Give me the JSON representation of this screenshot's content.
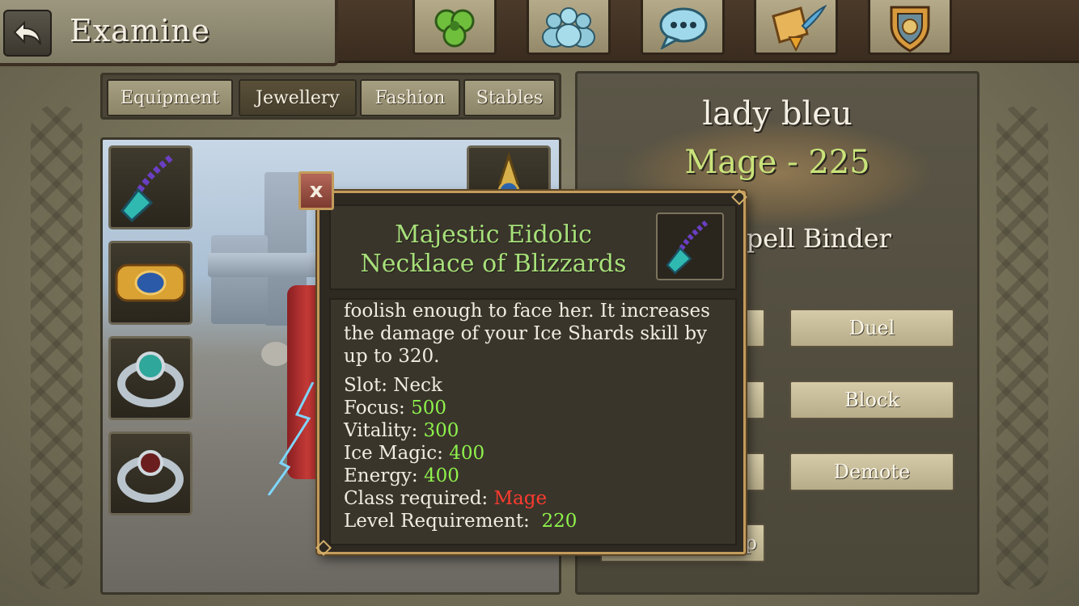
{
  "header": {
    "title": "Examine",
    "back_icon": "back-arrow-icon",
    "nav": [
      {
        "name": "triskele-icon"
      },
      {
        "name": "friends-icon"
      },
      {
        "name": "chat-icon"
      },
      {
        "name": "quest-scroll-icon"
      },
      {
        "name": "guild-shield-icon"
      }
    ]
  },
  "tabs": [
    {
      "label": "Equipment",
      "active": false
    },
    {
      "label": "Jewellery",
      "active": true
    },
    {
      "label": "Fashion",
      "active": false
    },
    {
      "label": "Stables",
      "active": false
    }
  ],
  "slots": [
    {
      "name": "necklace-slot"
    },
    {
      "name": "bracelet-slot"
    },
    {
      "name": "ring-slot-1"
    },
    {
      "name": "ring-slot-2"
    },
    {
      "name": "earring-slot"
    }
  ],
  "character": {
    "name": "lady bleu",
    "class_level": "Mage - 225",
    "guild_rank_partial": "n Spell Binder"
  },
  "actions": [
    {
      "label": "Duel"
    },
    {
      "label": "Block"
    },
    {
      "label": "Demote"
    },
    {
      "label": "p"
    }
  ],
  "tooltip": {
    "close_label": "x",
    "title": "Majestic Eidolic Necklace of Blizzards",
    "description": "foolish enough to face her. It increases the damage of your Ice Shards skill by up to 320.",
    "slot": "Slot: Neck",
    "focus_label": "Focus: ",
    "focus_value": "500",
    "vitality_label": "Vitality: ",
    "vitality_value": "300",
    "ice_magic_label": "Ice Magic: ",
    "ice_magic_value": "400",
    "energy_label": "Energy: ",
    "energy_value": "400",
    "class_label": "Class required: ",
    "class_value": "Mage",
    "level_label": "Level Requirement:  ",
    "level_value": "220"
  },
  "colors": {
    "stat_value": "#8ef24c",
    "class_required": "#ff3b2f",
    "item_title": "#a7e07a",
    "char_class": "#c9e37a"
  }
}
